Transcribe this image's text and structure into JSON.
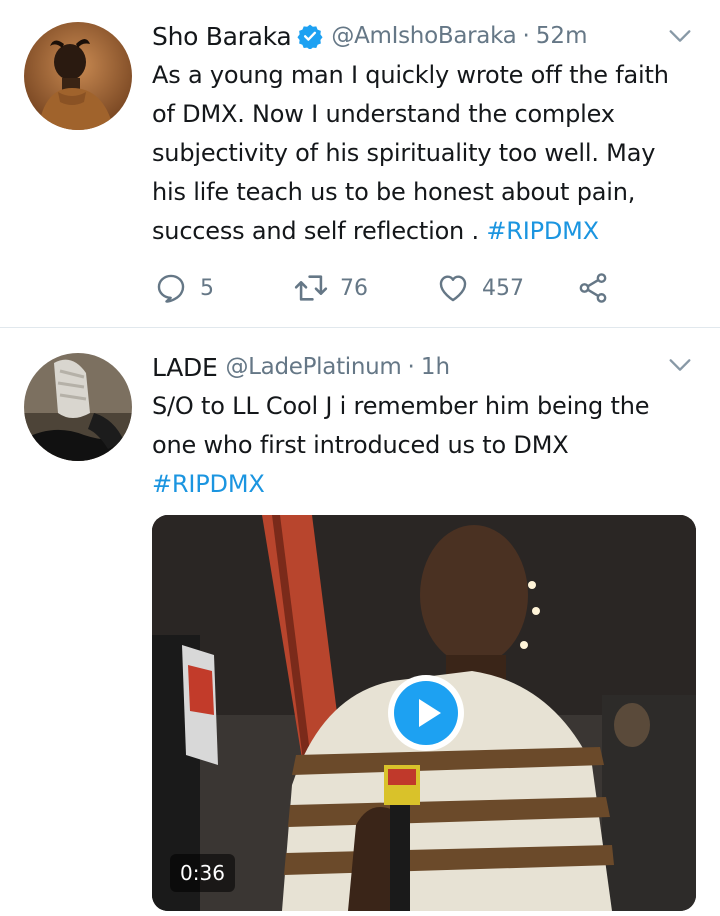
{
  "tweets": [
    {
      "display_name": "Sho Baraka",
      "handle": "@AmIshoBaraka",
      "separator": "·",
      "time": "52m",
      "text": "As a young man I quickly wrote off the faith of DMX. Now I understand the complex subjectivity of his spirituality too well. May his life teach us to be honest about pain, success and self reflection . ",
      "hashtag": "#RIPDMX",
      "replies": "5",
      "retweets": "76",
      "likes": "457",
      "verified": true
    },
    {
      "display_name": "LADE",
      "handle": "@LadePlatinum",
      "separator": "·",
      "time": "1h",
      "text": "S/O to LL Cool J i remember him being the one who first introduced us to DMX",
      "hashtag": "#RIPDMX",
      "video_duration": "0:36"
    }
  ],
  "colors": {
    "link": "#1b95e0",
    "verified": "#1da1f2",
    "secondary_text": "#657786",
    "play_button": "#1da1f2"
  },
  "icons": [
    "verified-icon",
    "chevron-down-icon",
    "reply-icon",
    "retweet-icon",
    "like-icon",
    "share-icon",
    "play-icon"
  ]
}
